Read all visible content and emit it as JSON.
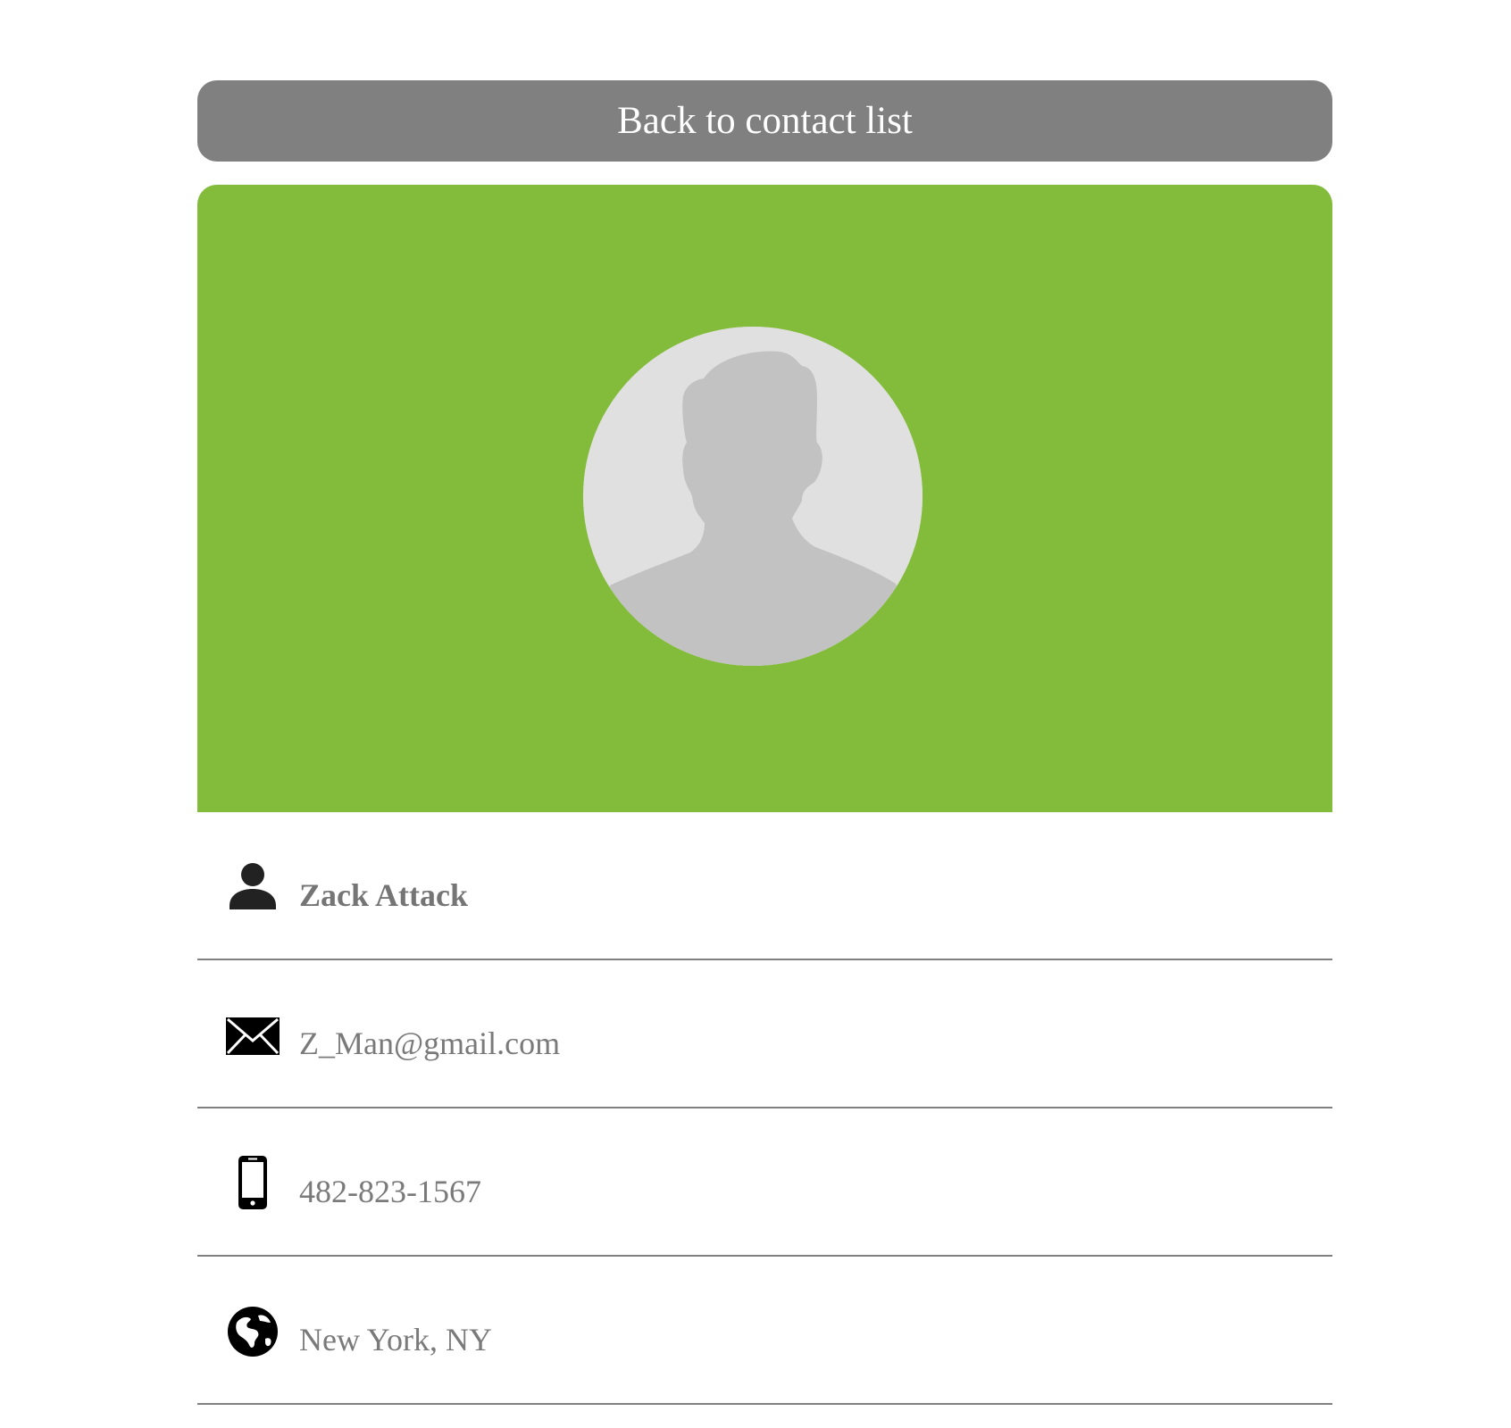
{
  "back_button": {
    "label": "Back to contact list"
  },
  "colors": {
    "hero_background": "#82bc3a",
    "button_background": "#808080",
    "avatar_background": "#e0e0e0",
    "avatar_silhouette": "#c2c2c2",
    "text": "#7a7a7a",
    "divider": "#808080"
  },
  "contact": {
    "avatar_icon": "person-silhouette-icon",
    "fields": [
      {
        "icon": "person-icon",
        "value": "Zack Attack"
      },
      {
        "icon": "envelope-icon",
        "value": "Z_Man@gmail.com"
      },
      {
        "icon": "mobile-phone-icon",
        "value": "482-823-1567"
      },
      {
        "icon": "globe-icon",
        "value": "New York, NY"
      }
    ]
  }
}
